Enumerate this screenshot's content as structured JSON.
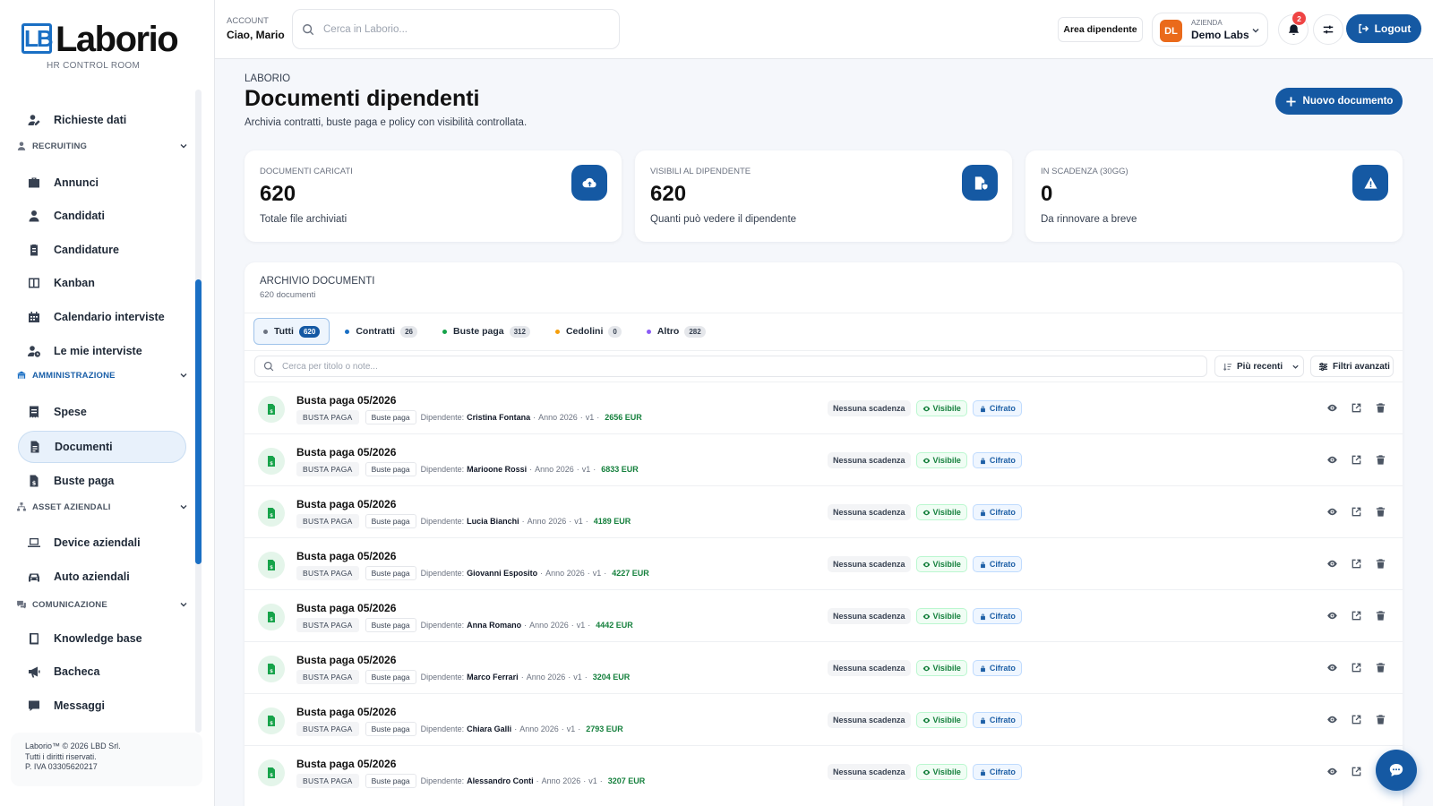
{
  "brand": {
    "logo_mark": "LB",
    "name": "Laborio",
    "tagline": "HR CONTROL ROOM"
  },
  "sidebar": {
    "items": [
      {
        "type": "item",
        "label": "Richieste dati",
        "icon": "user-edit-icon"
      },
      {
        "type": "section",
        "label": "RECRUITING",
        "icon": "user-icon"
      },
      {
        "type": "item",
        "label": "Annunci",
        "icon": "briefcase-icon"
      },
      {
        "type": "item",
        "label": "Candidati",
        "icon": "user-icon"
      },
      {
        "type": "item",
        "label": "Candidature",
        "icon": "clipboard-icon"
      },
      {
        "type": "item",
        "label": "Kanban",
        "icon": "columns-icon"
      },
      {
        "type": "item",
        "label": "Calendario interviste",
        "icon": "calendar-icon"
      },
      {
        "type": "item",
        "label": "Le mie interviste",
        "icon": "user-clock-icon"
      },
      {
        "type": "section",
        "label": "AMMINISTRAZIONE",
        "icon": "building-icon"
      },
      {
        "type": "item",
        "label": "Spese",
        "icon": "receipt-icon"
      },
      {
        "type": "item",
        "label": "Documenti",
        "icon": "document-icon",
        "active": true
      },
      {
        "type": "item",
        "label": "Buste paga",
        "icon": "payslip-icon"
      },
      {
        "type": "section",
        "label": "ASSET AZIENDALI",
        "icon": "sitemap-icon"
      },
      {
        "type": "item",
        "label": "Device aziendali",
        "icon": "laptop-icon"
      },
      {
        "type": "item",
        "label": "Auto aziendali",
        "icon": "car-icon"
      },
      {
        "type": "section",
        "label": "COMUNICAZIONE",
        "icon": "chat-icon"
      },
      {
        "type": "item",
        "label": "Knowledge base",
        "icon": "book-icon"
      },
      {
        "type": "item",
        "label": "Bacheca",
        "icon": "megaphone-icon"
      },
      {
        "type": "item",
        "label": "Messaggi",
        "icon": "message-icon"
      }
    ],
    "footer": [
      "Laborio™ © 2026 LBD Srl.",
      "Tutti i diritti riservati.",
      "P. IVA 03305620217"
    ]
  },
  "header": {
    "account_label": "ACCOUNT",
    "account_name": "Ciao, Mario",
    "search_placeholder": "Cerca in Laborio...",
    "area_button": "Area dipendente",
    "company_label": "AZIENDA",
    "company_name": "Demo Labs",
    "company_initials": "DL",
    "notifications_count": "2",
    "logout_label": "Logout"
  },
  "page": {
    "breadcrumb": "LABORIO",
    "title": "Documenti dipendenti",
    "subtitle": "Archivia contratti, buste paga e policy con visibilità controllata.",
    "new_button": "Nuovo documento"
  },
  "stats": [
    {
      "label": "DOCUMENTI CARICATI",
      "value": "620",
      "desc": "Totale file archiviati",
      "icon": "cloud-upload-icon"
    },
    {
      "label": "VISIBILI AL DIPENDENTE",
      "value": "620",
      "desc": "Quanti può vedere il dipendente",
      "icon": "file-shield-icon"
    },
    {
      "label": "IN SCADENZA (30GG)",
      "value": "0",
      "desc": "Da rinnovare a breve",
      "icon": "warning-icon"
    }
  ],
  "archive": {
    "title": "ARCHIVIO DOCUMENTI",
    "count_label": "620 documenti",
    "tabs": [
      {
        "label": "Tutti",
        "count": "620",
        "color": "#6b7280",
        "active": true
      },
      {
        "label": "Contratti",
        "count": "26",
        "color": "#1a6fc4"
      },
      {
        "label": "Buste paga",
        "count": "312",
        "color": "#16a34a"
      },
      {
        "label": "Cedolini",
        "count": "0",
        "color": "#f59e0b"
      },
      {
        "label": "Altro",
        "count": "282",
        "color": "#8b5cf6"
      }
    ],
    "search_placeholder": "Cerca per titolo o note...",
    "sort_label": "Più recenti",
    "advanced_filters_label": "Filtri avanzati",
    "labels": {
      "employee": "Dipendente:",
      "no_expiry": "Nessuna scadenza",
      "visible": "Visibile",
      "encrypted": "Cifrato"
    },
    "rows": [
      {
        "title": "Busta paga 05/2026",
        "type": "BUSTA PAGA",
        "category": "Buste paga",
        "employee": "Cristina Fontana",
        "year": "Anno 2026",
        "version": "v1",
        "amount": "2656 EUR"
      },
      {
        "title": "Busta paga 05/2026",
        "type": "BUSTA PAGA",
        "category": "Buste paga",
        "employee": "Marioone Rossi",
        "year": "Anno 2026",
        "version": "v1",
        "amount": "6833 EUR"
      },
      {
        "title": "Busta paga 05/2026",
        "type": "BUSTA PAGA",
        "category": "Buste paga",
        "employee": "Lucia Bianchi",
        "year": "Anno 2026",
        "version": "v1",
        "amount": "4189 EUR"
      },
      {
        "title": "Busta paga 05/2026",
        "type": "BUSTA PAGA",
        "category": "Buste paga",
        "employee": "Giovanni Esposito",
        "year": "Anno 2026",
        "version": "v1",
        "amount": "4227 EUR"
      },
      {
        "title": "Busta paga 05/2026",
        "type": "BUSTA PAGA",
        "category": "Buste paga",
        "employee": "Anna Romano",
        "year": "Anno 2026",
        "version": "v1",
        "amount": "4442 EUR"
      },
      {
        "title": "Busta paga 05/2026",
        "type": "BUSTA PAGA",
        "category": "Buste paga",
        "employee": "Marco Ferrari",
        "year": "Anno 2026",
        "version": "v1",
        "amount": "3204 EUR"
      },
      {
        "title": "Busta paga 05/2026",
        "type": "BUSTA PAGA",
        "category": "Buste paga",
        "employee": "Chiara Galli",
        "year": "Anno 2026",
        "version": "v1",
        "amount": "2793 EUR"
      },
      {
        "title": "Busta paga 05/2026",
        "type": "BUSTA PAGA",
        "category": "Buste paga",
        "employee": "Alessandro Conti",
        "year": "Anno 2026",
        "version": "v1",
        "amount": "3207 EUR"
      }
    ]
  }
}
